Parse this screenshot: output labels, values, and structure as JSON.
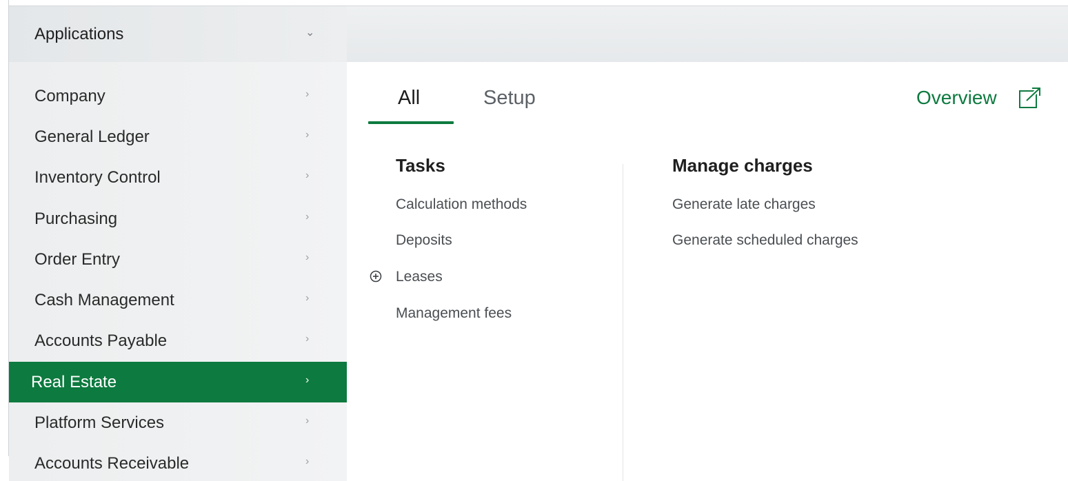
{
  "sidebar": {
    "header_label": "Applications",
    "items": [
      {
        "label": "Company",
        "active": false
      },
      {
        "label": "General Ledger",
        "active": false
      },
      {
        "label": "Inventory Control",
        "active": false
      },
      {
        "label": "Purchasing",
        "active": false
      },
      {
        "label": "Order Entry",
        "active": false
      },
      {
        "label": "Cash Management",
        "active": false
      },
      {
        "label": "Accounts Payable",
        "active": false
      },
      {
        "label": "Real Estate",
        "active": true
      },
      {
        "label": "Platform Services",
        "active": false
      },
      {
        "label": "Accounts Receivable",
        "active": false
      }
    ]
  },
  "tabs": [
    {
      "label": "All",
      "active": true
    },
    {
      "label": "Setup",
      "active": false
    }
  ],
  "overview_label": "Overview",
  "columns": {
    "tasks": {
      "title": "Tasks",
      "links": [
        "Calculation methods",
        "Deposits",
        "Leases",
        "Management fees"
      ]
    },
    "manage_charges": {
      "title": "Manage charges",
      "links": [
        "Generate late charges",
        "Generate scheduled charges"
      ]
    }
  },
  "colors": {
    "accent": "#0d7a3f",
    "sidebar_bg": "#eceeef",
    "text": "#222222"
  },
  "icons": {
    "collapse": "chevron-down-icon",
    "nav": "chevron-right-icon",
    "overview": "external-link-icon",
    "expand_leases": "plus-circle-icon"
  }
}
